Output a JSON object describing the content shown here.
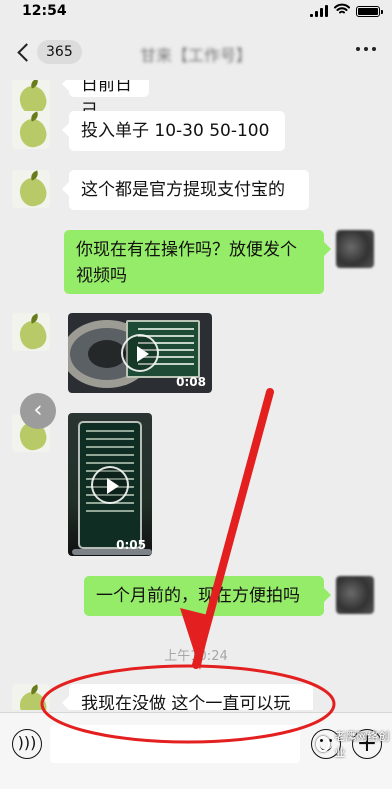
{
  "status_bar": {
    "time": "12:54"
  },
  "header": {
    "unread_count": "365",
    "chat_title": "甘来【工作号】"
  },
  "messages": [
    {
      "side": "left",
      "text": "日前日己"
    },
    {
      "side": "left",
      "text": "投入单子 10-30 50-100"
    },
    {
      "side": "left",
      "text": "这个都是官方提现支付宝的"
    },
    {
      "side": "right",
      "text": "你现在有在操作吗？放便发个\n视频吗"
    },
    {
      "side": "left",
      "type": "video",
      "duration": "0:08"
    },
    {
      "side": "left",
      "type": "video",
      "duration": "0:05"
    },
    {
      "side": "right",
      "text": "一个月前的，现在方便拍吗"
    },
    {
      "type": "timestamp",
      "text": "上午10:24"
    },
    {
      "side": "left",
      "text": "我现在没做 这个一直可以玩"
    }
  ],
  "watermark": {
    "text": "老鹰网络创业"
  },
  "colors": {
    "background": "#ededed",
    "incoming_bubble": "#ffffff",
    "outgoing_bubble": "#95ec69",
    "annotation": "#e31f1f"
  }
}
